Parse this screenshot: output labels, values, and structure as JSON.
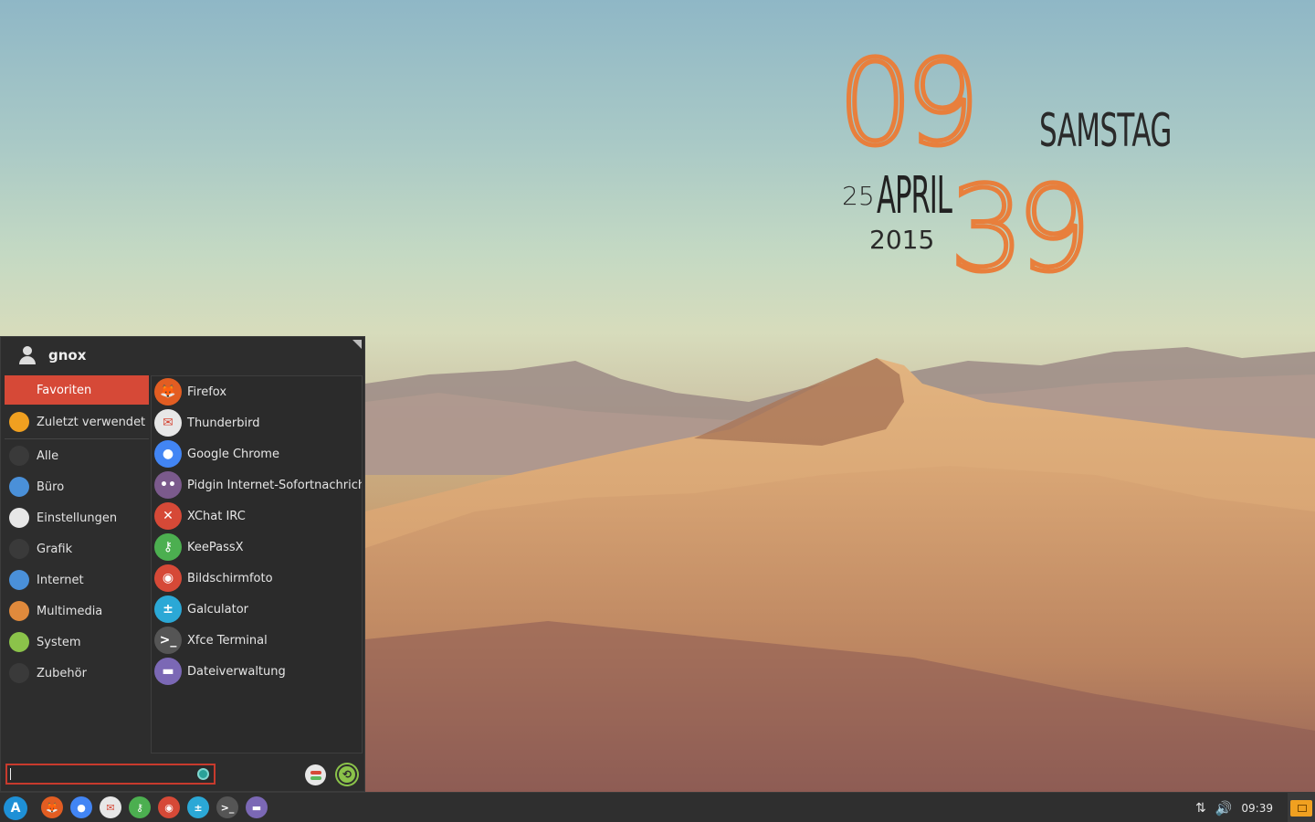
{
  "clock": {
    "hour": "09",
    "minute": "39",
    "dayname": "SAMSTAG",
    "day": "25",
    "month": "APRIL",
    "year": "2015"
  },
  "menu": {
    "username": "gnox",
    "categories": [
      {
        "label": "Favoriten",
        "icon": "bookmark-icon",
        "color": "#d64937"
      },
      {
        "label": "Zuletzt verwendet",
        "icon": "recent-icon",
        "color": "#f0a020"
      },
      {
        "label": "Alle",
        "icon": "all-apps-icon",
        "color": "#3a3a3a"
      },
      {
        "label": "Büro",
        "icon": "office-icon",
        "color": "#4a90d9"
      },
      {
        "label": "Einstellungen",
        "icon": "settings-icon",
        "color": "#e7e7e7"
      },
      {
        "label": "Grafik",
        "icon": "graphics-icon",
        "color": "#3a3a3a"
      },
      {
        "label": "Internet",
        "icon": "internet-icon",
        "color": "#4a90d9"
      },
      {
        "label": "Multimedia",
        "icon": "multimedia-icon",
        "color": "#e08a3c"
      },
      {
        "label": "System",
        "icon": "system-icon",
        "color": "#8bc34a"
      },
      {
        "label": "Zubehör",
        "icon": "accessories-icon",
        "color": "#3a3a3a"
      }
    ],
    "apps": [
      {
        "label": "Firefox",
        "icon": "firefox-icon",
        "color": "#e25d22",
        "glyph": "🦊"
      },
      {
        "label": "Thunderbird",
        "icon": "thunderbird-icon",
        "color": "#e7e7e7",
        "glyph": "✉"
      },
      {
        "label": "Google Chrome",
        "icon": "chrome-icon",
        "color": "#4285f4",
        "glyph": "●"
      },
      {
        "label": "Pidgin Internet-Sofortnachrich...",
        "icon": "pidgin-icon",
        "color": "#7b5a8c",
        "glyph": "••"
      },
      {
        "label": "XChat IRC",
        "icon": "xchat-icon",
        "color": "#d64937",
        "glyph": "✕"
      },
      {
        "label": "KeePassX",
        "icon": "keepassx-icon",
        "color": "#4caf50",
        "glyph": "⚷"
      },
      {
        "label": "Bildschirmfoto",
        "icon": "screenshot-icon",
        "color": "#d64937",
        "glyph": "◉"
      },
      {
        "label": "Galculator",
        "icon": "calculator-icon",
        "color": "#2ba8d6",
        "glyph": "±"
      },
      {
        "label": "Xfce Terminal",
        "icon": "terminal-icon",
        "color": "#555555",
        "glyph": ">_"
      },
      {
        "label": "Dateiverwaltung",
        "icon": "file-manager-icon",
        "color": "#7b68b5",
        "glyph": "▬"
      }
    ],
    "search": {
      "value": "",
      "placeholder": ""
    }
  },
  "taskbar": {
    "start_glyph": "A",
    "launchers": [
      {
        "name": "firefox",
        "color": "#e25d22",
        "glyph": "🦊"
      },
      {
        "name": "chrome",
        "color": "#4285f4",
        "glyph": "●"
      },
      {
        "name": "thunderbird",
        "color": "#e7e7e7",
        "glyph": "✉"
      },
      {
        "name": "keepassx",
        "color": "#4caf50",
        "glyph": "⚷"
      },
      {
        "name": "screenshot",
        "color": "#d64937",
        "glyph": "◉"
      },
      {
        "name": "calculator",
        "color": "#2ba8d6",
        "glyph": "±"
      },
      {
        "name": "terminal",
        "color": "#555555",
        "glyph": ">_"
      },
      {
        "name": "file-manager",
        "color": "#7b68b5",
        "glyph": "▬"
      }
    ],
    "time": "09:39"
  },
  "colors": {
    "accent": "#d64937",
    "clock_orange": "#e87f3c",
    "panel_bg": "#2d2d2d"
  }
}
